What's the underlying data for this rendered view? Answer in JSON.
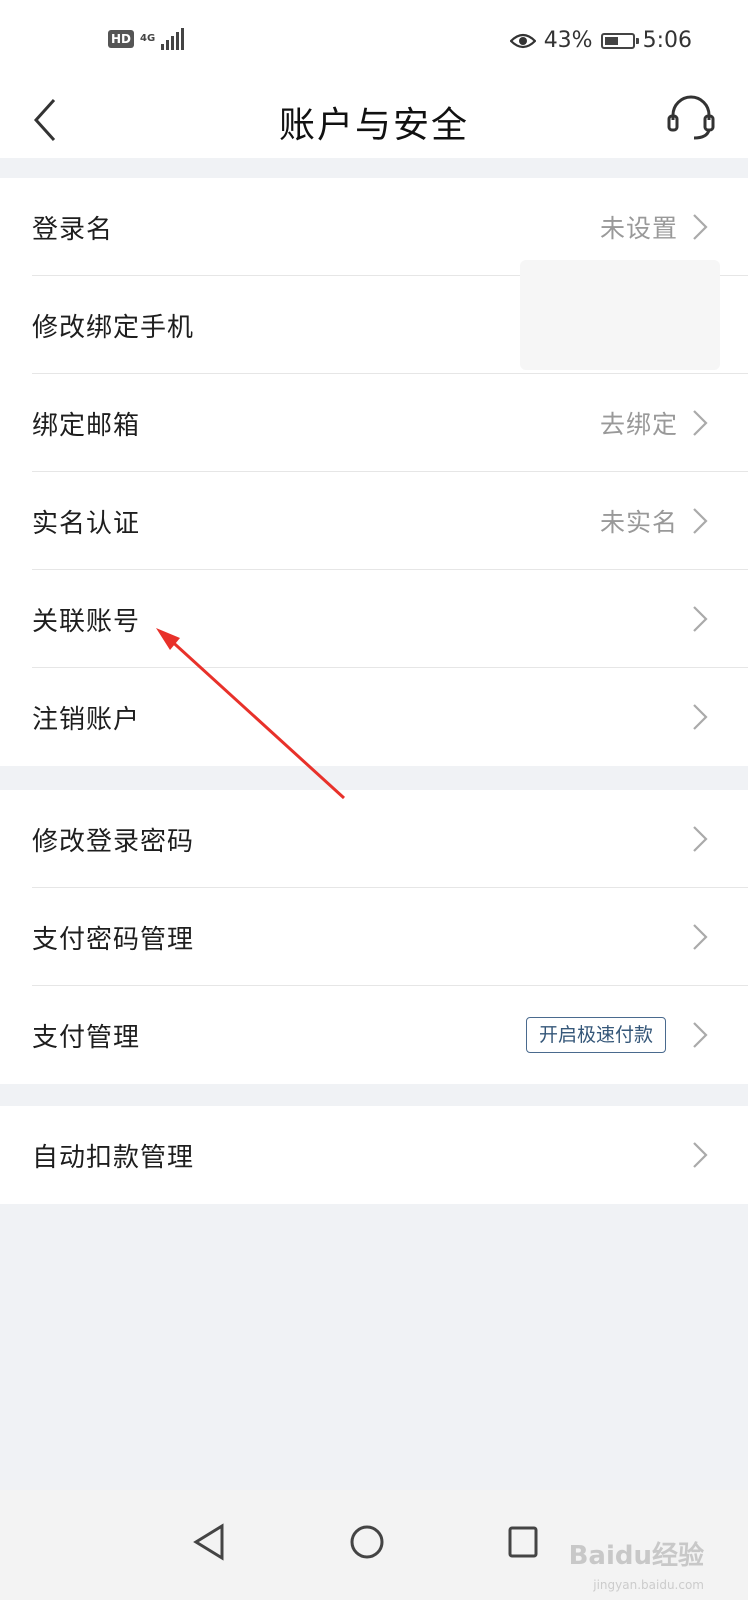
{
  "status": {
    "hd": "HD",
    "network": "4G",
    "battery_text": "43%",
    "time": "5:06"
  },
  "header": {
    "title": "账户与安全"
  },
  "groups": [
    {
      "items": [
        {
          "label": "登录名",
          "value": "未设置"
        },
        {
          "label": "修改绑定手机",
          "value": ""
        },
        {
          "label": "绑定邮箱",
          "value": "去绑定"
        },
        {
          "label": "实名认证",
          "value": "未实名"
        },
        {
          "label": "关联账号",
          "value": ""
        },
        {
          "label": "注销账户",
          "value": ""
        }
      ]
    },
    {
      "items": [
        {
          "label": "修改登录密码",
          "value": ""
        },
        {
          "label": "支付密码管理",
          "value": ""
        },
        {
          "label": "支付管理",
          "badge": "开启极速付款"
        }
      ]
    },
    {
      "items": [
        {
          "label": "自动扣款管理",
          "value": ""
        }
      ]
    }
  ],
  "watermark": {
    "text": "Baidu经验",
    "sub": "jingyan.baidu.com"
  },
  "colors": {
    "annotation_arrow": "#e8312a",
    "badge_border": "#4a6a8e",
    "background": "#f0f2f5"
  }
}
